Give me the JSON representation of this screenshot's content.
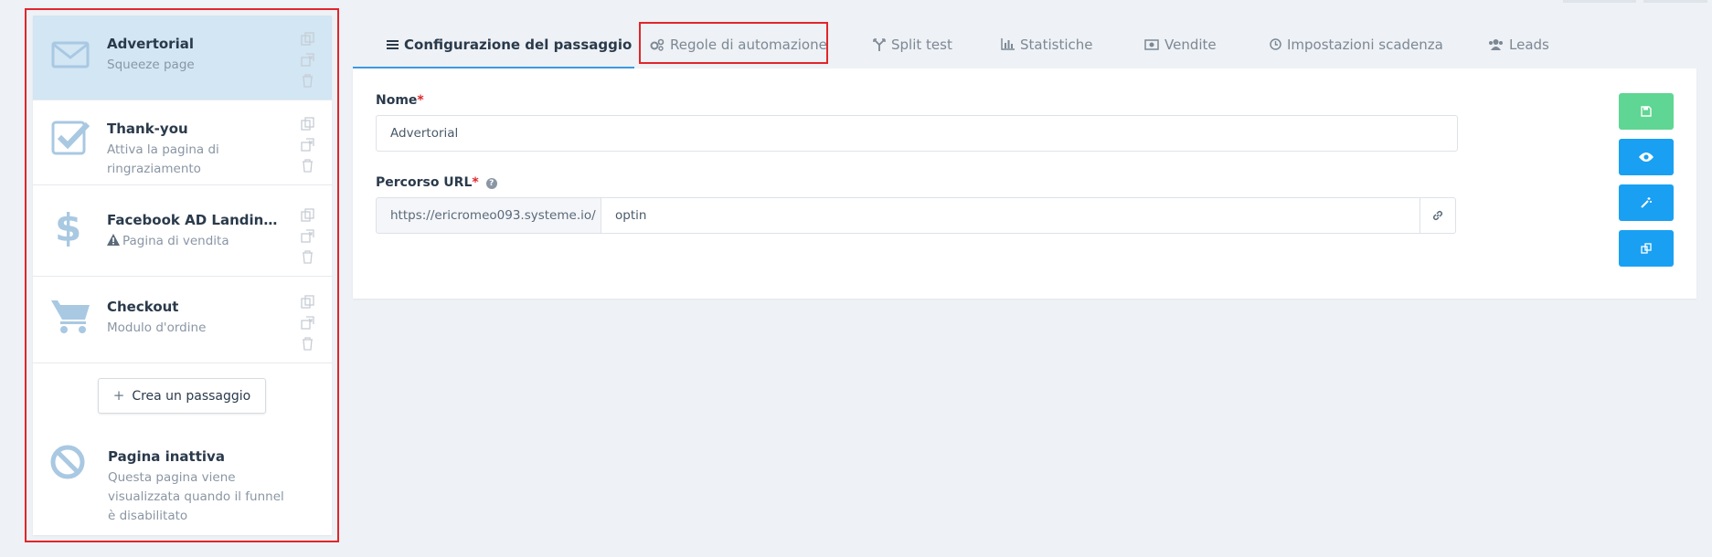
{
  "sidebar": {
    "steps": [
      {
        "title": "Advertorial",
        "subtitle": "Squeeze page",
        "icon": "envelope-icon",
        "active": true
      },
      {
        "title": "Thank-you",
        "subtitle": "Attiva la pagina di ringraziamento",
        "icon": "check-square-icon",
        "active": false
      },
      {
        "title": "Facebook AD Landing...",
        "subtitle": "Pagina di vendita",
        "icon": "dollar-icon",
        "warning": true,
        "active": false
      },
      {
        "title": "Checkout",
        "subtitle": "Modulo d'ordine",
        "icon": "cart-icon",
        "active": false
      }
    ],
    "create_label": "Crea un passaggio",
    "inactive": {
      "title": "Pagina inattiva",
      "subtitle": "Questa pagina viene visualizzata quando il funnel è disabilitato",
      "icon": "ban-icon"
    }
  },
  "tabs": [
    {
      "label": "Configurazione del passaggio",
      "icon": "bars-icon",
      "active": true
    },
    {
      "label": "Regole di automazione",
      "icon": "cogs-icon",
      "active": false
    },
    {
      "label": "Split test",
      "icon": "split-icon",
      "active": false
    },
    {
      "label": "Statistiche",
      "icon": "bar-chart-icon",
      "active": false
    },
    {
      "label": "Vendite",
      "icon": "money-icon",
      "active": false
    },
    {
      "label": "Impostazioni scadenza",
      "icon": "clock-icon",
      "active": false
    },
    {
      "label": "Leads",
      "icon": "users-icon",
      "active": false
    }
  ],
  "form": {
    "name_label": "Nome",
    "name_required": "*",
    "name_value": "Advertorial",
    "url_label": "Percorso URL",
    "url_required": "*",
    "url_help": "?",
    "url_prefix": "https://ericromeo093.systeme.io/",
    "url_value": "optin"
  },
  "action_buttons": [
    {
      "name": "save-button",
      "icon": "save-icon",
      "color": "#5fd693"
    },
    {
      "name": "preview-button",
      "icon": "eye-icon",
      "color": "#1aa0f2"
    },
    {
      "name": "edit-button",
      "icon": "magic-wand-icon",
      "color": "#1aa0f2"
    },
    {
      "name": "duplicate-button",
      "icon": "copy-icon",
      "color": "#1aa0f2"
    }
  ],
  "colors": {
    "accent": "#3d98e3",
    "highlight": "#e0262b",
    "active_step_bg": "#d2e6f4",
    "icon_blue": "#a9c8e2"
  }
}
